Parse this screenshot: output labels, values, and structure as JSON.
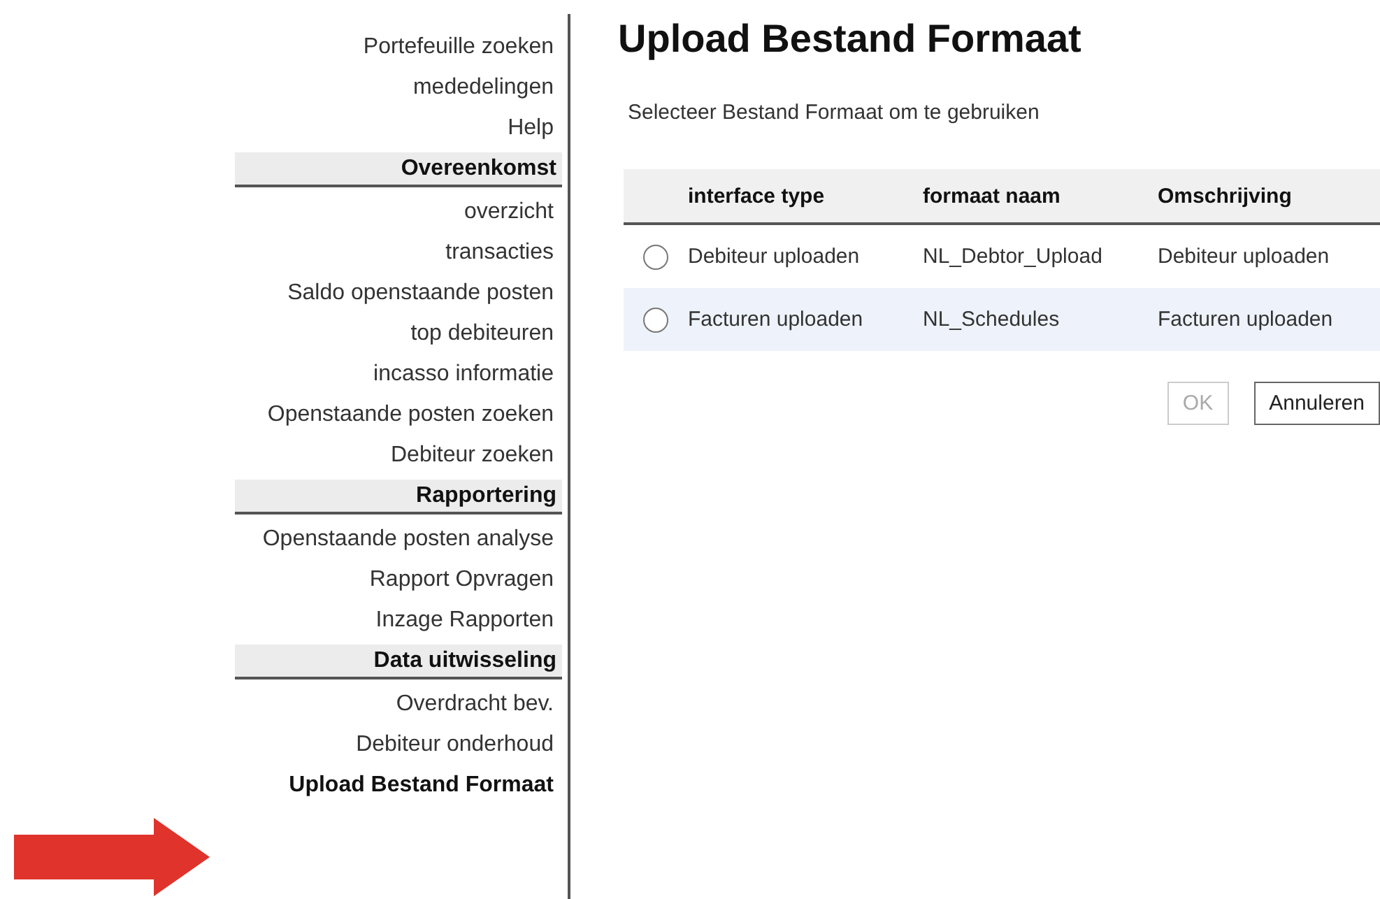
{
  "sidebar": {
    "items": [
      {
        "kind": "link",
        "label": "Portefeuille zoeken"
      },
      {
        "kind": "link",
        "label": "mededelingen"
      },
      {
        "kind": "link",
        "label": "Help"
      },
      {
        "kind": "header",
        "label": "Overeenkomst"
      },
      {
        "kind": "link",
        "label": "overzicht"
      },
      {
        "kind": "link",
        "label": "transacties"
      },
      {
        "kind": "link",
        "label": "Saldo openstaande posten"
      },
      {
        "kind": "link",
        "label": "top debiteuren"
      },
      {
        "kind": "link",
        "label": "incasso informatie"
      },
      {
        "kind": "link",
        "label": "Openstaande posten zoeken"
      },
      {
        "kind": "link",
        "label": "Debiteur zoeken"
      },
      {
        "kind": "header",
        "label": "Rapportering"
      },
      {
        "kind": "link",
        "label": "Openstaande posten analyse"
      },
      {
        "kind": "link",
        "label": "Rapport Opvragen"
      },
      {
        "kind": "link",
        "label": "Inzage Rapporten"
      },
      {
        "kind": "header",
        "label": "Data uitwisseling"
      },
      {
        "kind": "link",
        "label": "Overdracht bev."
      },
      {
        "kind": "link",
        "label": "Debiteur onderhoud"
      },
      {
        "kind": "current",
        "label": "Upload Bestand Formaat"
      }
    ]
  },
  "page": {
    "title": "Upload Bestand Formaat",
    "subtitle": "Selecteer Bestand Formaat om te gebruiken"
  },
  "table": {
    "columns": [
      "interface type",
      "formaat naam",
      "Omschrijving"
    ],
    "rows": [
      {
        "selected": false,
        "shaded": false,
        "cells": [
          "Debiteur uploaden",
          "NL_Debtor_Upload",
          "Debiteur uploaden"
        ]
      },
      {
        "selected": false,
        "shaded": true,
        "cells": [
          "Facturen uploaden",
          "NL_Schedules",
          "Facturen uploaden"
        ]
      }
    ]
  },
  "buttons": [
    {
      "label": "OK",
      "disabled": true
    },
    {
      "label": "Annuleren",
      "disabled": false
    }
  ]
}
